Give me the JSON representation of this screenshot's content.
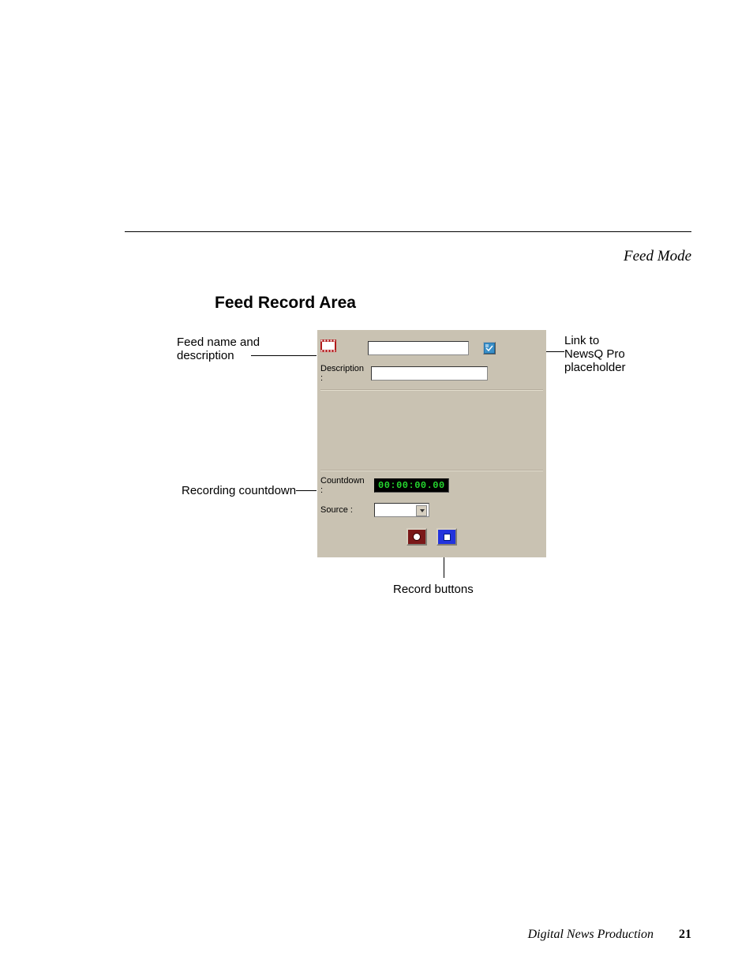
{
  "header": {
    "right": "Feed Mode"
  },
  "section": {
    "title": "Feed Record Area"
  },
  "callouts": {
    "feed_name_line1": "Feed name and",
    "feed_name_line2": "description",
    "countdown": "Recording countdown",
    "link_line1": "Link to",
    "link_line2": "NewsQ Pro",
    "link_line3": "placeholder",
    "record_buttons": "Record buttons"
  },
  "panel": {
    "description_label": "Description :",
    "countdown_label": "Countdown :",
    "countdown_value": "00:00:00.00",
    "source_label": "Source :",
    "name_value": "",
    "description_value": "",
    "source_value": ""
  },
  "footer": {
    "title": "Digital News Production",
    "page": "21"
  }
}
